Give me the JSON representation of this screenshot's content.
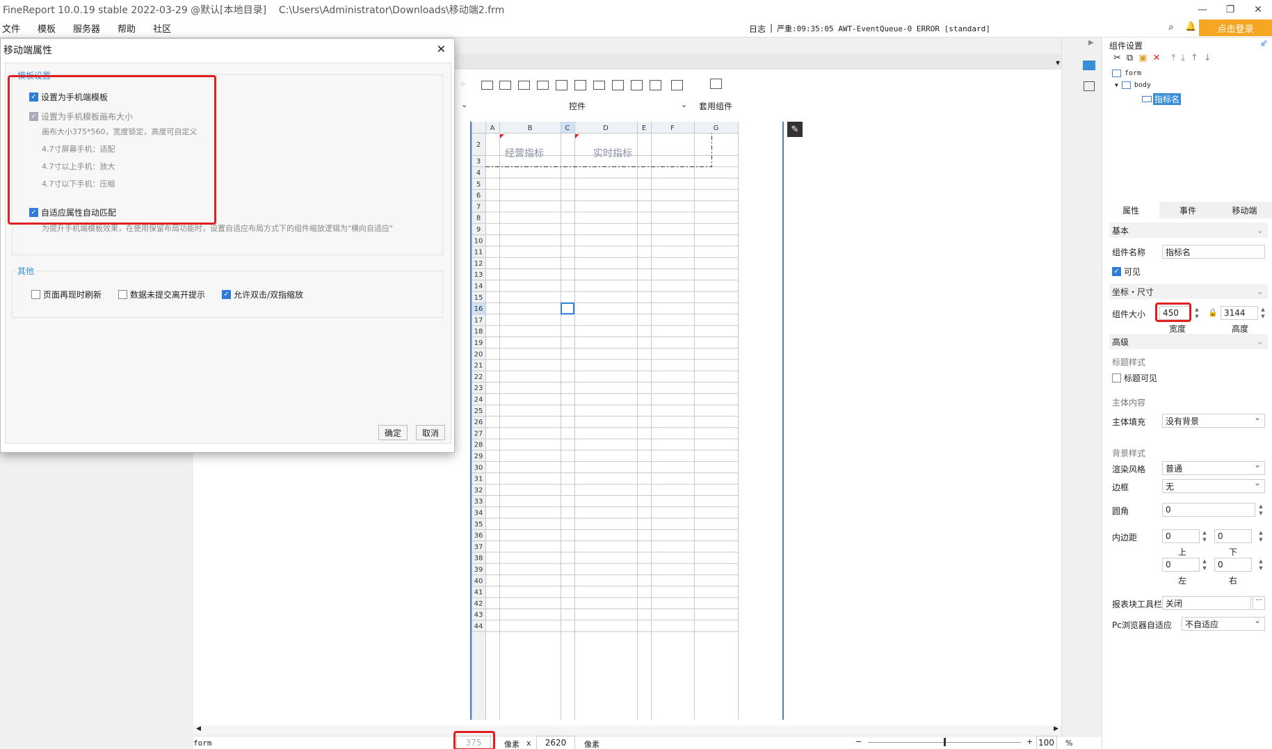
{
  "window": {
    "title": "FineReport 10.0.19 stable 2022-03-29 @默认[本地目录]    C:\\Users\\Administrator\\Downloads\\移动端2.frm",
    "minimize": "—",
    "restore": "❐",
    "close": "✕"
  },
  "menu": [
    "文件",
    "模板",
    "服务器",
    "帮助",
    "社区"
  ],
  "log": {
    "label": "日志",
    "message": "严重:09:35:05 AWT-EventQueue-0 ERROR [standard]"
  },
  "login_label": "点击登录",
  "controls": {
    "label": "控件",
    "template_widgets": "套用组件"
  },
  "grid": {
    "columns": [
      "A",
      "B",
      "C",
      "D",
      "E",
      "F",
      "G"
    ],
    "rows": [
      "2",
      "3",
      "4",
      "5",
      "6",
      "7",
      "8",
      "9",
      "10",
      "11",
      "12",
      "13",
      "14",
      "15",
      "16",
      "17",
      "18",
      "19",
      "20",
      "21",
      "22",
      "23",
      "24",
      "25",
      "26",
      "27",
      "28",
      "29",
      "30",
      "31",
      "32",
      "33",
      "34",
      "35",
      "36",
      "37",
      "38",
      "39",
      "40",
      "41",
      "42",
      "43",
      "44"
    ],
    "cell_b2": "经营指标",
    "cell_d2": "实时指标"
  },
  "dialog": {
    "title": "移动端属性",
    "group1_title": "模板设置",
    "set_mobile_template": "设置为手机端模板",
    "set_canvas_size": "设置为手机模板画布大小",
    "canvas_hint": "画布大小375*560，宽度锁定，高度可自定义",
    "hint_47_fit": "4.7寸屏幕手机：适配",
    "hint_47_above": "4.7寸以上手机：放大",
    "hint_47_below": "4.7寸以下手机：压缩",
    "auto_match": "自适应属性自动匹配",
    "auto_match_hint": "为提升手机端模板效果，在使用保留布局功能时，设置自适应布局方式下的组件缩放逻辑为\"横向自适应\"",
    "group2_title": "其他",
    "refresh": "页面再现时刷新",
    "unsubmitted": "数据未提交离开提示",
    "allow_zoom": "允许双击/双指缩放",
    "ok": "确定",
    "cancel": "取消"
  },
  "panel": {
    "title": "组件设置",
    "tree": [
      "form",
      "body",
      "指标名"
    ],
    "tabs": [
      "属性",
      "事件",
      "移动端"
    ],
    "basic": "基本",
    "widget_name_label": "组件名称",
    "widget_name": "指标名",
    "visible": "可见",
    "coords": "坐标・尺寸",
    "size_label": "组件大小",
    "width": "450",
    "height": "3144",
    "width_label": "宽度",
    "height_label": "高度",
    "advanced": "高级",
    "title_style": "标题样式",
    "title_visible": "标题可见",
    "body_content": "主体内容",
    "body_fill_label": "主体填充",
    "body_fill": "没有背景",
    "bg_style": "背景样式",
    "render_label": "渲染风格",
    "render": "普通",
    "border_label": "边框",
    "border": "无",
    "radius_label": "圆角",
    "radius": "0",
    "padding_label": "内边距",
    "pad_top": "0",
    "pad_bottom": "0",
    "pad_left": "0",
    "pad_right": "0",
    "top": "上",
    "bottom": "下",
    "left": "左",
    "right": "右",
    "toolbar_label": "报表块工具栏",
    "toolbar_value": "关闭",
    "pc_label": "Pc浏览器自适应",
    "pc_value": "不自适应"
  },
  "status": {
    "form": "form",
    "canvas_w": "375",
    "px1": "像素",
    "x": "x",
    "canvas_h": "2620",
    "px2": "像素",
    "zoom": "100",
    "pct": "%"
  }
}
